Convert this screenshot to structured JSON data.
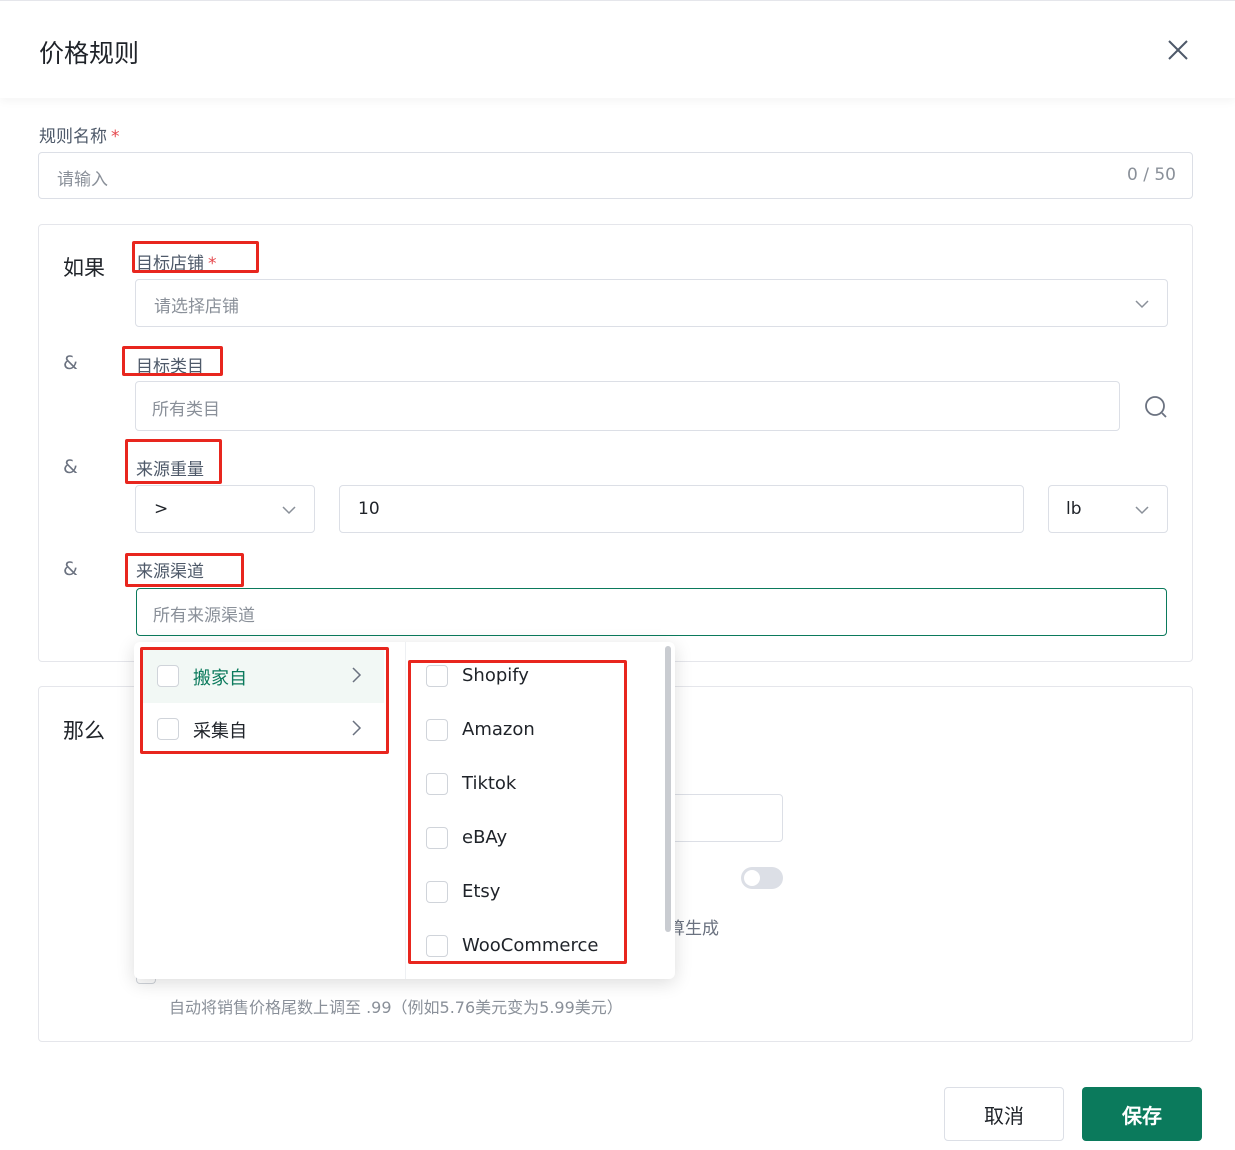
{
  "dialog": {
    "title": "价格规则"
  },
  "rule_name": {
    "label": "规则名称",
    "required_mark": "*",
    "placeholder": "请输入",
    "counter": "0 / 50"
  },
  "if_section": {
    "title": "如果",
    "and_symbol": "&",
    "target_store": {
      "label": "目标店铺",
      "required_mark": "*",
      "placeholder": "请选择店铺"
    },
    "target_category": {
      "label": "目标类目",
      "placeholder": "所有类目"
    },
    "source_weight": {
      "label": "来源重量",
      "operator": ">",
      "value": "10",
      "unit": "lb"
    },
    "source_channel": {
      "label": "来源渠道",
      "placeholder": "所有来源渠道"
    }
  },
  "then_section": {
    "title": "那么",
    "partial_text": "算生成",
    "rounding_desc": "自动将销售价格尾数上调至 .99（例如5.76美元变为5.99美元）"
  },
  "channel_dropdown": {
    "groups": [
      {
        "label": "搬家自",
        "active": true
      },
      {
        "label": "采集自",
        "active": false
      }
    ],
    "options": [
      "Shopify",
      "Amazon",
      "Tiktok",
      "eBAy",
      "Etsy",
      "WooCommerce"
    ]
  },
  "footer": {
    "cancel_label": "取消",
    "save_label": "保存"
  },
  "colors": {
    "primary": "#0b7a5c",
    "highlight_box": "#e8261e",
    "required": "#e5484d"
  }
}
